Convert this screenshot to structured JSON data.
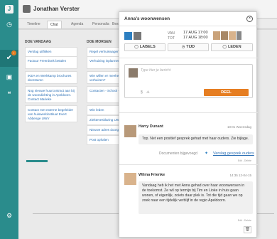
{
  "header": {
    "name": "Jonathan Verster"
  },
  "tabs": [
    "Timeline",
    "Chat",
    "Agenda",
    "Personalia",
    "Bestanden"
  ],
  "board": {
    "columns": [
      {
        "title": "DOE VANDAAG",
        "cards": [
          "Verslag uitfikken",
          "Factuur Freerdonk betalen",
          "IKEA en Werkkamp brochures doorsturen",
          "Nog nieuwe huurcontract aan bij de woondichting in Apeldoorn. Contact Marieke",
          "Contact met externe begeleider van huiswerkinstituut Evert Abbenge UWV"
        ]
      },
      {
        "title": "DOE MORGEN",
        "cards": [
          "Regel verhuiswagen",
          "Verhuizing inplannen",
          "Wie willen er meehelpen met verhuizen?",
          "Contacten - School - Ouders",
          "Win leden",
          "Ziektevesklaring UWV",
          "Nieuwe adres doorgeven",
          "Post ophalen"
        ]
      }
    ]
  },
  "modal": {
    "title": "Anna’s woonwensen",
    "van_label": "VAN",
    "tot_label": "TOT",
    "van_value": "17 AUG 17:00",
    "tot_value": "17 AUG 18:00",
    "buttons": [
      "LABELS",
      "TIJD",
      "LEDEN"
    ],
    "composer": {
      "placeholder": "Type hier je bericht",
      "submit": "DEEL"
    },
    "posts": [
      {
        "author": "Harry Dunant",
        "time": "10:01 Woensdag",
        "text": "Top. Net een positief gesprek gehad met haar ouders. Zie bijlage.",
        "doc_label": "Documenten bijgevoegd",
        "doc_link": "Verslag gesprek ouders",
        "actions": "Edit - Delete"
      },
      {
        "author": "Wilma Frienke",
        "time": "14:35 12-04-15",
        "text": "Vandaag heb ik het met Anna gehad over haar woonwensen in de toekomst. Ze wil op termijn bij Tim en Lioke in huis gaan wonen, of eigenlijk, zoiets daar plek is. Tot die tijd gaan we op zoek naar een tijdelijk verblijf in de regio Apeldoorn.",
        "actions": "Edit - Delete"
      }
    ]
  }
}
